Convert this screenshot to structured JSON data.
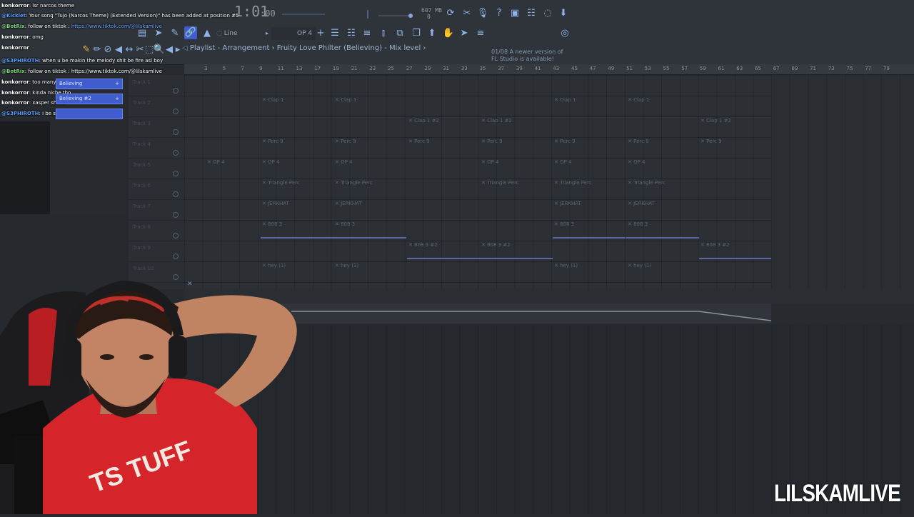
{
  "toolbar": {
    "time_display": "1:01",
    "time_sub": ":00",
    "memory": "607 MB",
    "memory_sub": "0",
    "tool_mode": "Line",
    "pattern": "OP 4",
    "update_notice": {
      "line1": "01/08  A newer version of",
      "line2": "FL Studio is available!"
    }
  },
  "breadcrumb": "Playlist - Arrangement › Fruity Love Philter (Believing) - Mix level ›",
  "ruler_ticks": [
    "3",
    "5",
    "7",
    "9",
    "11",
    "13",
    "17",
    "19",
    "21",
    "23",
    "25",
    "27",
    "29",
    "31",
    "33",
    "35",
    "37",
    "39",
    "41",
    "43",
    "45",
    "47",
    "49",
    "51",
    "53",
    "55",
    "57",
    "59",
    "61",
    "63",
    "65",
    "67",
    "69",
    "71",
    "73",
    "75",
    "77",
    "79"
  ],
  "tracks": [
    {
      "name": "Track 1"
    },
    {
      "name": "Track 2"
    },
    {
      "name": "Track 3"
    },
    {
      "name": "Track 4"
    },
    {
      "name": "Track 5"
    },
    {
      "name": "Track 6"
    },
    {
      "name": "Track 7"
    },
    {
      "name": "Track 8"
    },
    {
      "name": "Track 9"
    },
    {
      "name": "Track 10"
    }
  ],
  "clips": {
    "clap1": "Clap 1",
    "clap1_2": "Clap 1 #2",
    "perc9": "Perc 9",
    "op4": "OP 4",
    "triangle": "Triangle Perc",
    "jerkhat": "JERKHAT",
    "b808_3": "808 3",
    "b808_3_2": "808 3 #2",
    "hey": "hey (1)"
  },
  "patterns_panel": {
    "item1": "Believing",
    "item2": "Believing #2"
  },
  "chat": [
    {
      "user": "konkorror",
      "text": ": lsr narcos theme"
    },
    {
      "user": "@Kicklet",
      "text": ": Your song \"Tujo (Narcos Theme) (Extended Version)\" has been added at position #5"
    },
    {
      "user": "@BotRix",
      "text": ": follow on tiktok : ",
      "link": "https://www.tiktok.com/@lilskamlive"
    },
    {
      "user": "konkorror",
      "text": ": omg"
    },
    {
      "user": "konkorror",
      "text": ""
    },
    {
      "user": "@S3PHIROTH",
      "text": ": when u be makin the melody shit be fire asl boy"
    },
    {
      "user": "@BotRix",
      "text": ": follow on tiktok : https://www.tiktok.com/@lilskamlive"
    },
    {
      "user": "konkorror",
      "text": ": too many bridges rxk"
    },
    {
      "user": "konkorror",
      "text": ": kinda niche tho"
    },
    {
      "user": "konkorror",
      "text": ": xasper shrek"
    },
    {
      "user": "@S3PHIROTH",
      "text": ": i be seein ur do sum r&b shit"
    }
  ],
  "watermark": "LILSKAMLIVE",
  "colors": {
    "accent_blue": "#3f5dce",
    "clip_line": "#5a6aa0",
    "shirt_red": "#d6252a"
  }
}
